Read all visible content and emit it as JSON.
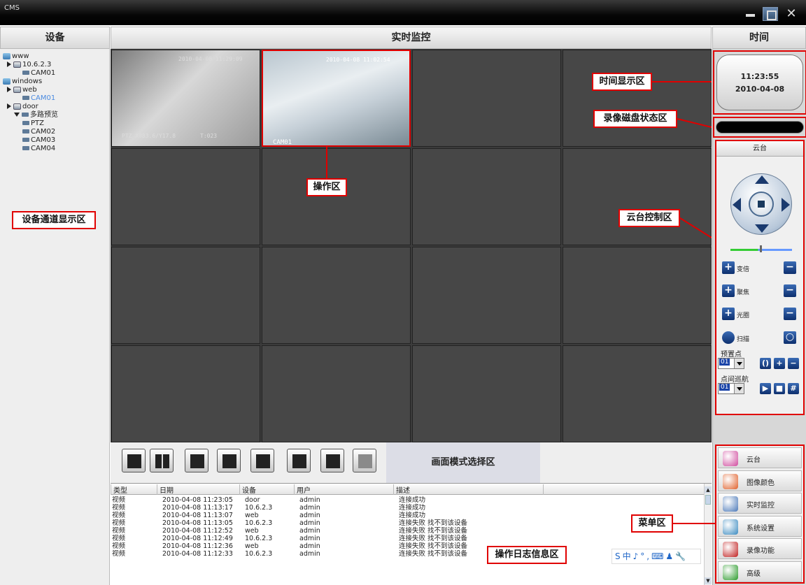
{
  "window": {
    "title": "CMS"
  },
  "headers": {
    "devices": "设备",
    "monitor": "实时监控",
    "time": "时间"
  },
  "tree": [
    {
      "label": "www",
      "kind": "group"
    },
    {
      "label": "10.6.2.3",
      "kind": "dvr"
    },
    {
      "label": "CAM01",
      "kind": "cam"
    },
    {
      "label": "windows",
      "kind": "group"
    },
    {
      "label": "web",
      "kind": "dvr"
    },
    {
      "label": "CAM01",
      "kind": "cam"
    },
    {
      "label": "door",
      "kind": "dvr"
    },
    {
      "label": "多路预览",
      "kind": "cam"
    },
    {
      "label": "PTZ",
      "kind": "cam"
    },
    {
      "label": "CAM02",
      "kind": "cam"
    },
    {
      "label": "CAM03",
      "kind": "cam"
    },
    {
      "label": "CAM04",
      "kind": "cam"
    }
  ],
  "annotations": {
    "device_channel_area": "设备通道显示区",
    "operation_area": "操作区",
    "time_display_area": "时间显示区",
    "disk_status_area": "录像磁盘状态区",
    "ptz_control_area": "云台控制区",
    "log_area": "操作日志信息区",
    "menu_area": "菜单区",
    "mode_area": "画面模式选择区"
  },
  "video": {
    "cell1": {
      "top_osd": "2010-04-08 11:29:09",
      "bottom_osd": "PTZ X083.6/Y17.8",
      "tag": "T:023"
    },
    "cell2": {
      "top_osd": "2010-04-08 11:02:54",
      "bottom_osd": "CAM01"
    }
  },
  "clock": {
    "time": "11:23:55",
    "date": "2010-04-08"
  },
  "ptz": {
    "title": "云台",
    "zoom": "变倍",
    "focus": "聚焦",
    "iris": "光圈",
    "scan": "扫描",
    "preset_label": "预置点",
    "preset_value": "01",
    "cruise_label": "点间巡航",
    "cruise_value": "01"
  },
  "menu": [
    {
      "label": "云台",
      "color": "#d04a9e"
    },
    {
      "label": "图像颜色",
      "color": "#e0602a"
    },
    {
      "label": "实时监控",
      "color": "#4a78b8"
    },
    {
      "label": "系统设置",
      "color": "#3a8ac0"
    },
    {
      "label": "录像功能",
      "color": "#c02020"
    },
    {
      "label": "高级",
      "color": "#2a9a2a"
    }
  ],
  "log": {
    "columns": [
      "类型",
      "日期",
      "设备",
      "用户",
      "描述"
    ],
    "rows": [
      [
        "视频",
        "2010-04-08 11:23:05",
        "door",
        "admin",
        "连接成功"
      ],
      [
        "视频",
        "2010-04-08 11:13:17",
        "10.6.2.3",
        "admin",
        "连接成功"
      ],
      [
        "视频",
        "2010-04-08 11:13:07",
        "web",
        "admin",
        "连接成功"
      ],
      [
        "视频",
        "2010-04-08 11:13:05",
        "10.6.2.3",
        "admin",
        "连接失败 找不到该设备"
      ],
      [
        "视频",
        "2010-04-08 11:12:52",
        "web",
        "admin",
        "连接失败 找不到该设备"
      ],
      [
        "视频",
        "2010-04-08 11:12:49",
        "10.6.2.3",
        "admin",
        "连接失败 找不到该设备"
      ],
      [
        "视频",
        "2010-04-08 11:12:36",
        "web",
        "admin",
        "连接失败 找不到该设备"
      ],
      [
        "视频",
        "2010-04-08 11:12:33",
        "10.6.2.3",
        "admin",
        "连接失败 找不到该设备"
      ]
    ]
  },
  "ime": {
    "text": "S中♪°,⌨♟🔧"
  },
  "colors": {
    "accent_red": "#e00000",
    "titlebar": "#000000"
  }
}
